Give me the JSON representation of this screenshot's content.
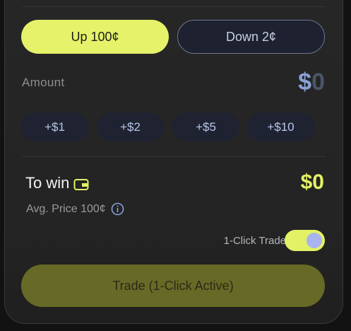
{
  "outcomes": {
    "up_label": "Up 100¢",
    "down_label": "Down 2¢"
  },
  "amount": {
    "label": "Amount",
    "currency": "$",
    "value": "0"
  },
  "quick_add": [
    "+$1",
    "+$2",
    "+$5",
    "+$10"
  ],
  "to_win": {
    "label": "To win",
    "value": "$0",
    "icon": "wallet-icon"
  },
  "avg_price": {
    "text": "Avg. Price 100¢",
    "icon": "info-icon"
  },
  "one_click": {
    "label": "1-Click Trade",
    "enabled": true
  },
  "trade_button": {
    "label": "Trade (1-Click Active)"
  },
  "colors": {
    "accent": "#e3f164",
    "panel": "#262626",
    "chip": "#1f2331",
    "muted_blue": "#8aa1d6"
  }
}
